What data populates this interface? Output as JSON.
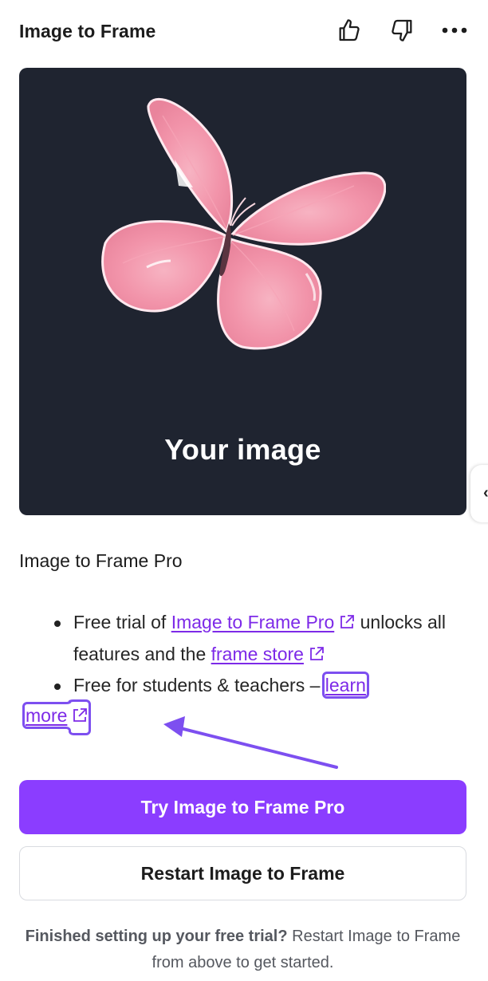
{
  "header": {
    "title": "Image to Frame",
    "icons": [
      "thumbs-up-icon",
      "thumbs-down-icon",
      "more-options-icon"
    ]
  },
  "preview": {
    "label": "Your image",
    "background": "#1f2430"
  },
  "pro_section": {
    "title": "Image to Frame Pro",
    "bullet1": {
      "prefix": "Free trial of ",
      "link1": "Image to Frame Pro",
      "middle": " unlocks all features and the ",
      "link2": "frame store"
    },
    "bullet2": {
      "prefix": "Free for students & teachers – ",
      "link_part1": "learn",
      "link_part2": "more"
    }
  },
  "buttons": {
    "primary": "Try Image to Frame Pro",
    "secondary": "Restart Image to Frame"
  },
  "footer": {
    "bold": "Finished setting up your free trial?",
    "rest": " Restart Image to Frame from above to get started."
  },
  "colors": {
    "accent": "#8b3dff",
    "link": "#7d2ae8",
    "annotation": "#7d4ff0"
  }
}
